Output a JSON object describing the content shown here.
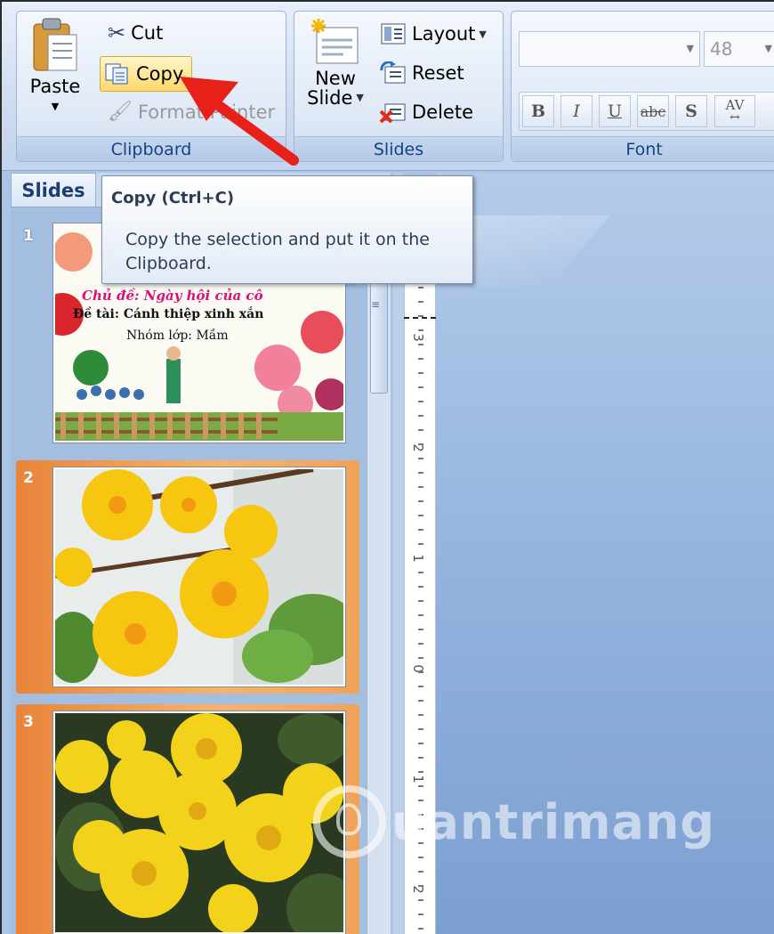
{
  "ribbon": {
    "clipboard": {
      "paste_label": "Paste",
      "cut_label": "Cut",
      "copy_label": "Copy",
      "format_painter_label": "Format Painter",
      "group_label": "Clipboard"
    },
    "slides": {
      "new_slide_line1": "New",
      "new_slide_line2": "Slide",
      "layout_label": "Layout",
      "reset_label": "Reset",
      "delete_label": "Delete",
      "group_label": "Slides"
    },
    "font": {
      "font_name_value": "",
      "font_size_value": "48",
      "bold": "B",
      "italic": "I",
      "underline": "U",
      "strikethrough": "abc",
      "shadow": "S",
      "spacing": "AV",
      "group_label": "Font"
    }
  },
  "tooltip": {
    "title": "Copy (Ctrl+C)",
    "body": "Copy the selection and put it on the Clipboard."
  },
  "left_pane": {
    "tab_label": "Slides",
    "slides": [
      {
        "number": "1",
        "line1": "Chủ đề: Ngày hội của cô",
        "line2": "Đề tài: Cánh thiệp xinh xắn",
        "line3": "Nhóm lớp: Mầm"
      },
      {
        "number": "2"
      },
      {
        "number": "3"
      }
    ]
  },
  "ruler": {
    "labels": [
      "3",
      "2",
      "1",
      "0",
      "1",
      "2"
    ]
  },
  "watermark": {
    "text": "uantrimang"
  },
  "colors": {
    "annotation_arrow": "#e8201a",
    "selected_slide": "#f0a25a",
    "ribbon_label": "#15428b"
  }
}
